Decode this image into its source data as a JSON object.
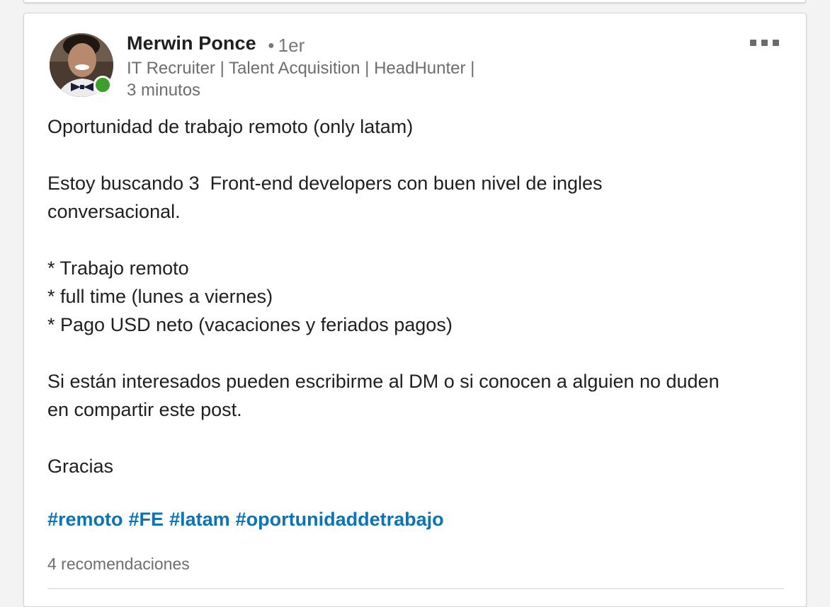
{
  "post": {
    "author": {
      "name": "Merwin Ponce",
      "degree": "1er",
      "headline": "IT Recruiter | Talent Acquisition | HeadHunter |",
      "time": "3 minutos",
      "online": true
    },
    "body_lines": [
      "Oportunidad de trabajo remoto (only latam)",
      "",
      "Estoy buscando 3  Front-end developers con buen nivel de ingles",
      "conversacional.",
      "",
      "* Trabajo remoto",
      "* full time (lunes a viernes)",
      "* Pago USD neto (vacaciones y feriados pagos)",
      "",
      "Si están interesados pueden escribirme al DM o si conocen a alguien no duden",
      "en compartir este post.",
      "",
      "Gracias"
    ],
    "hashtags": [
      "#remoto",
      "#FE",
      "#latam",
      "#oportunidaddetrabajo"
    ],
    "reactions": "4 recomendaciones"
  },
  "icons": {
    "more": "more-horizontal-icon",
    "presence": "online-presence-icon"
  },
  "colors": {
    "hashtag": "#0a74b8",
    "presence": "#3aa02a",
    "text": "#1f1f1f",
    "secondary_text": "#6e6e6e"
  }
}
